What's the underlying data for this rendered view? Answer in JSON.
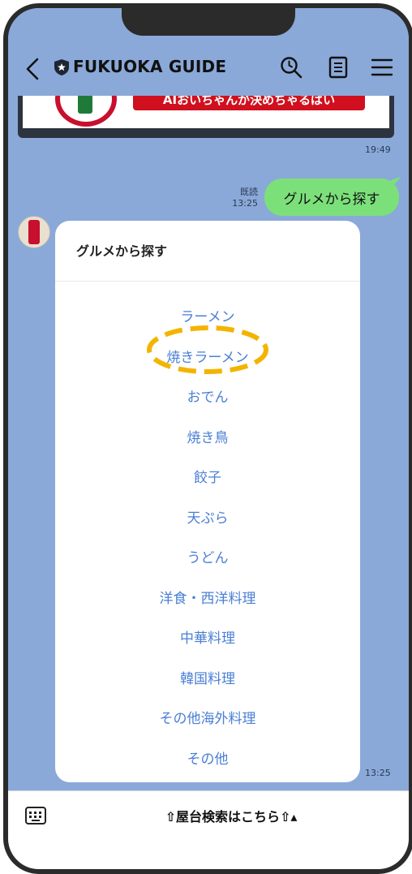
{
  "header": {
    "title": "FUKUOKA GUIDE"
  },
  "banner": {
    "text": "AIおいちゃんが決めちゃるばい"
  },
  "messages": {
    "banner_time": "19:49",
    "read_label": "既読",
    "user_time": "13:25",
    "user_message": "グルメから探す",
    "bot_time": "13:25"
  },
  "card": {
    "title": "グルメから探す",
    "items": [
      "ラーメン",
      "焼きラーメン",
      "おでん",
      "焼き鳥",
      "餃子",
      "天ぷら",
      "うどん",
      "洋食・西洋料理",
      "中華料理",
      "韓国料理",
      "その他海外料理",
      "その他"
    ]
  },
  "bottom_bar": {
    "label": "⇧屋台検索はこちら⇧▴"
  },
  "colors": {
    "background": "#8aa9d8",
    "bubble": "#7be07a",
    "link": "#4a7fd4",
    "highlight": "#f3b400"
  },
  "icons": [
    "back-icon",
    "shield-icon",
    "history-search-icon",
    "notes-icon",
    "menu-icon",
    "keyboard-icon"
  ]
}
